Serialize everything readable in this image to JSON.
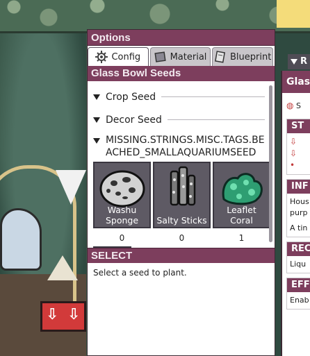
{
  "options": {
    "title": "Options",
    "tabs": [
      {
        "label": "Config",
        "icon": "gear-icon",
        "active": true
      },
      {
        "label": "Material",
        "icon": "material-icon",
        "active": false
      },
      {
        "label": "Blueprint",
        "icon": "blueprint-icon",
        "active": false
      }
    ],
    "section_title": "Glass Bowl Seeds",
    "categories": [
      {
        "label": "Crop Seed"
      },
      {
        "label": "Decor Seed"
      },
      {
        "label": "MISSING.STRINGS.MISC.TAGS.BEACHED_SMALLAQUARIUMSEED"
      }
    ],
    "seeds": [
      {
        "name": "Washu Sponge",
        "count": "0",
        "icon": "sponge-icon"
      },
      {
        "name": "Salty Sticks",
        "count": "0",
        "icon": "salty-sticks-icon"
      },
      {
        "name": "Leaflet Coral",
        "count": "1",
        "icon": "coral-icon"
      }
    ],
    "select_title": "SELECT",
    "select_text": "Select a seed to plant."
  },
  "detail_panel": {
    "tab_label": "R",
    "title": "Glass",
    "row_icon_text": "S",
    "sections": [
      {
        "header": "ST"
      },
      {
        "header": "INF",
        "lines": [
          "Hous",
          "purp",
          "A tin"
        ]
      },
      {
        "header": "REC",
        "lines": [
          "Liqu"
        ]
      },
      {
        "header": "EFF",
        "lines": [
          "Enab"
        ]
      }
    ]
  },
  "colors": {
    "header": "#7d3e5d",
    "panel_bg": "#ffffff",
    "seed_card": "#5e5a64",
    "accent_red": "#d23a3a"
  }
}
